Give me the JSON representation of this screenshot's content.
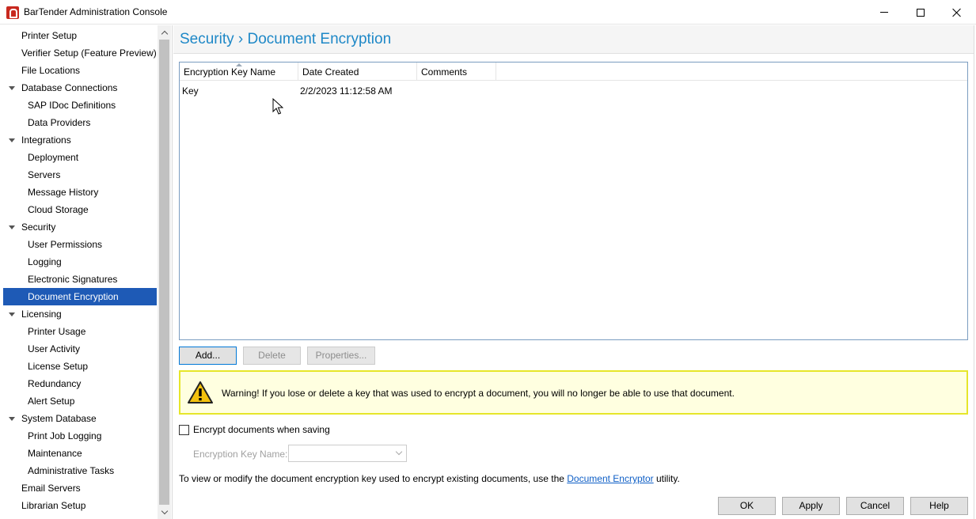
{
  "window": {
    "title": "BarTender Administration Console"
  },
  "sidebar": {
    "items": [
      {
        "label": "Printer Setup",
        "level": 0,
        "expandable": false,
        "selected": false
      },
      {
        "label": "Verifier Setup (Feature Preview)",
        "level": 0,
        "expandable": false,
        "selected": false
      },
      {
        "label": "File Locations",
        "level": 0,
        "expandable": false,
        "selected": false
      },
      {
        "label": "Database Connections",
        "level": 0,
        "expandable": true,
        "selected": false
      },
      {
        "label": "SAP IDoc Definitions",
        "level": 1,
        "expandable": false,
        "selected": false
      },
      {
        "label": "Data Providers",
        "level": 1,
        "expandable": false,
        "selected": false
      },
      {
        "label": "Integrations",
        "level": 0,
        "expandable": true,
        "selected": false
      },
      {
        "label": "Deployment",
        "level": 1,
        "expandable": false,
        "selected": false
      },
      {
        "label": "Servers",
        "level": 1,
        "expandable": false,
        "selected": false
      },
      {
        "label": "Message History",
        "level": 1,
        "expandable": false,
        "selected": false
      },
      {
        "label": "Cloud Storage",
        "level": 1,
        "expandable": false,
        "selected": false
      },
      {
        "label": "Security",
        "level": 0,
        "expandable": true,
        "selected": false
      },
      {
        "label": "User Permissions",
        "level": 1,
        "expandable": false,
        "selected": false
      },
      {
        "label": "Logging",
        "level": 1,
        "expandable": false,
        "selected": false
      },
      {
        "label": "Electronic Signatures",
        "level": 1,
        "expandable": false,
        "selected": false
      },
      {
        "label": "Document Encryption",
        "level": 1,
        "expandable": false,
        "selected": true
      },
      {
        "label": "Licensing",
        "level": 0,
        "expandable": true,
        "selected": false
      },
      {
        "label": "Printer Usage",
        "level": 1,
        "expandable": false,
        "selected": false
      },
      {
        "label": "User Activity",
        "level": 1,
        "expandable": false,
        "selected": false
      },
      {
        "label": "License Setup",
        "level": 1,
        "expandable": false,
        "selected": false
      },
      {
        "label": "Redundancy",
        "level": 1,
        "expandable": false,
        "selected": false
      },
      {
        "label": "Alert Setup",
        "level": 1,
        "expandable": false,
        "selected": false
      },
      {
        "label": "System Database",
        "level": 0,
        "expandable": true,
        "selected": false
      },
      {
        "label": "Print Job Logging",
        "level": 1,
        "expandable": false,
        "selected": false
      },
      {
        "label": "Maintenance",
        "level": 1,
        "expandable": false,
        "selected": false
      },
      {
        "label": "Administrative Tasks",
        "level": 1,
        "expandable": false,
        "selected": false
      },
      {
        "label": "Email Servers",
        "level": 0,
        "expandable": false,
        "selected": false
      },
      {
        "label": "Librarian Setup",
        "level": 0,
        "expandable": false,
        "selected": false
      }
    ]
  },
  "main": {
    "title": "Security › Document Encryption",
    "table": {
      "columns": [
        "Encryption Key Name",
        "Date Created",
        "Comments"
      ],
      "rows": [
        {
          "name": "Key",
          "date_created": "2/2/2023 11:12:58 AM",
          "comments": ""
        }
      ]
    },
    "buttons": {
      "add": "Add...",
      "delete": "Delete",
      "properties": "Properties..."
    },
    "warning_text": "Warning! If you lose or delete a key that was used to encrypt a document, you will no longer be able to use that document.",
    "encrypt_checkbox": {
      "label": "Encrypt documents when saving",
      "checked": false
    },
    "encryption_key_name": {
      "label": "Encryption Key Name:",
      "value": ""
    },
    "info": {
      "prefix": "To view or modify the document encryption key used to encrypt existing documents, use the ",
      "link": "Document Encryptor",
      "suffix": " utility."
    }
  },
  "footer": {
    "ok": "OK",
    "apply": "Apply",
    "cancel": "Cancel",
    "help": "Help"
  },
  "colors": {
    "accent": "#1e88c7",
    "selection": "#1e5ab6",
    "warning_bg": "#ffffe0",
    "warning_border": "#e6e62a",
    "link": "#0f5fc6"
  }
}
